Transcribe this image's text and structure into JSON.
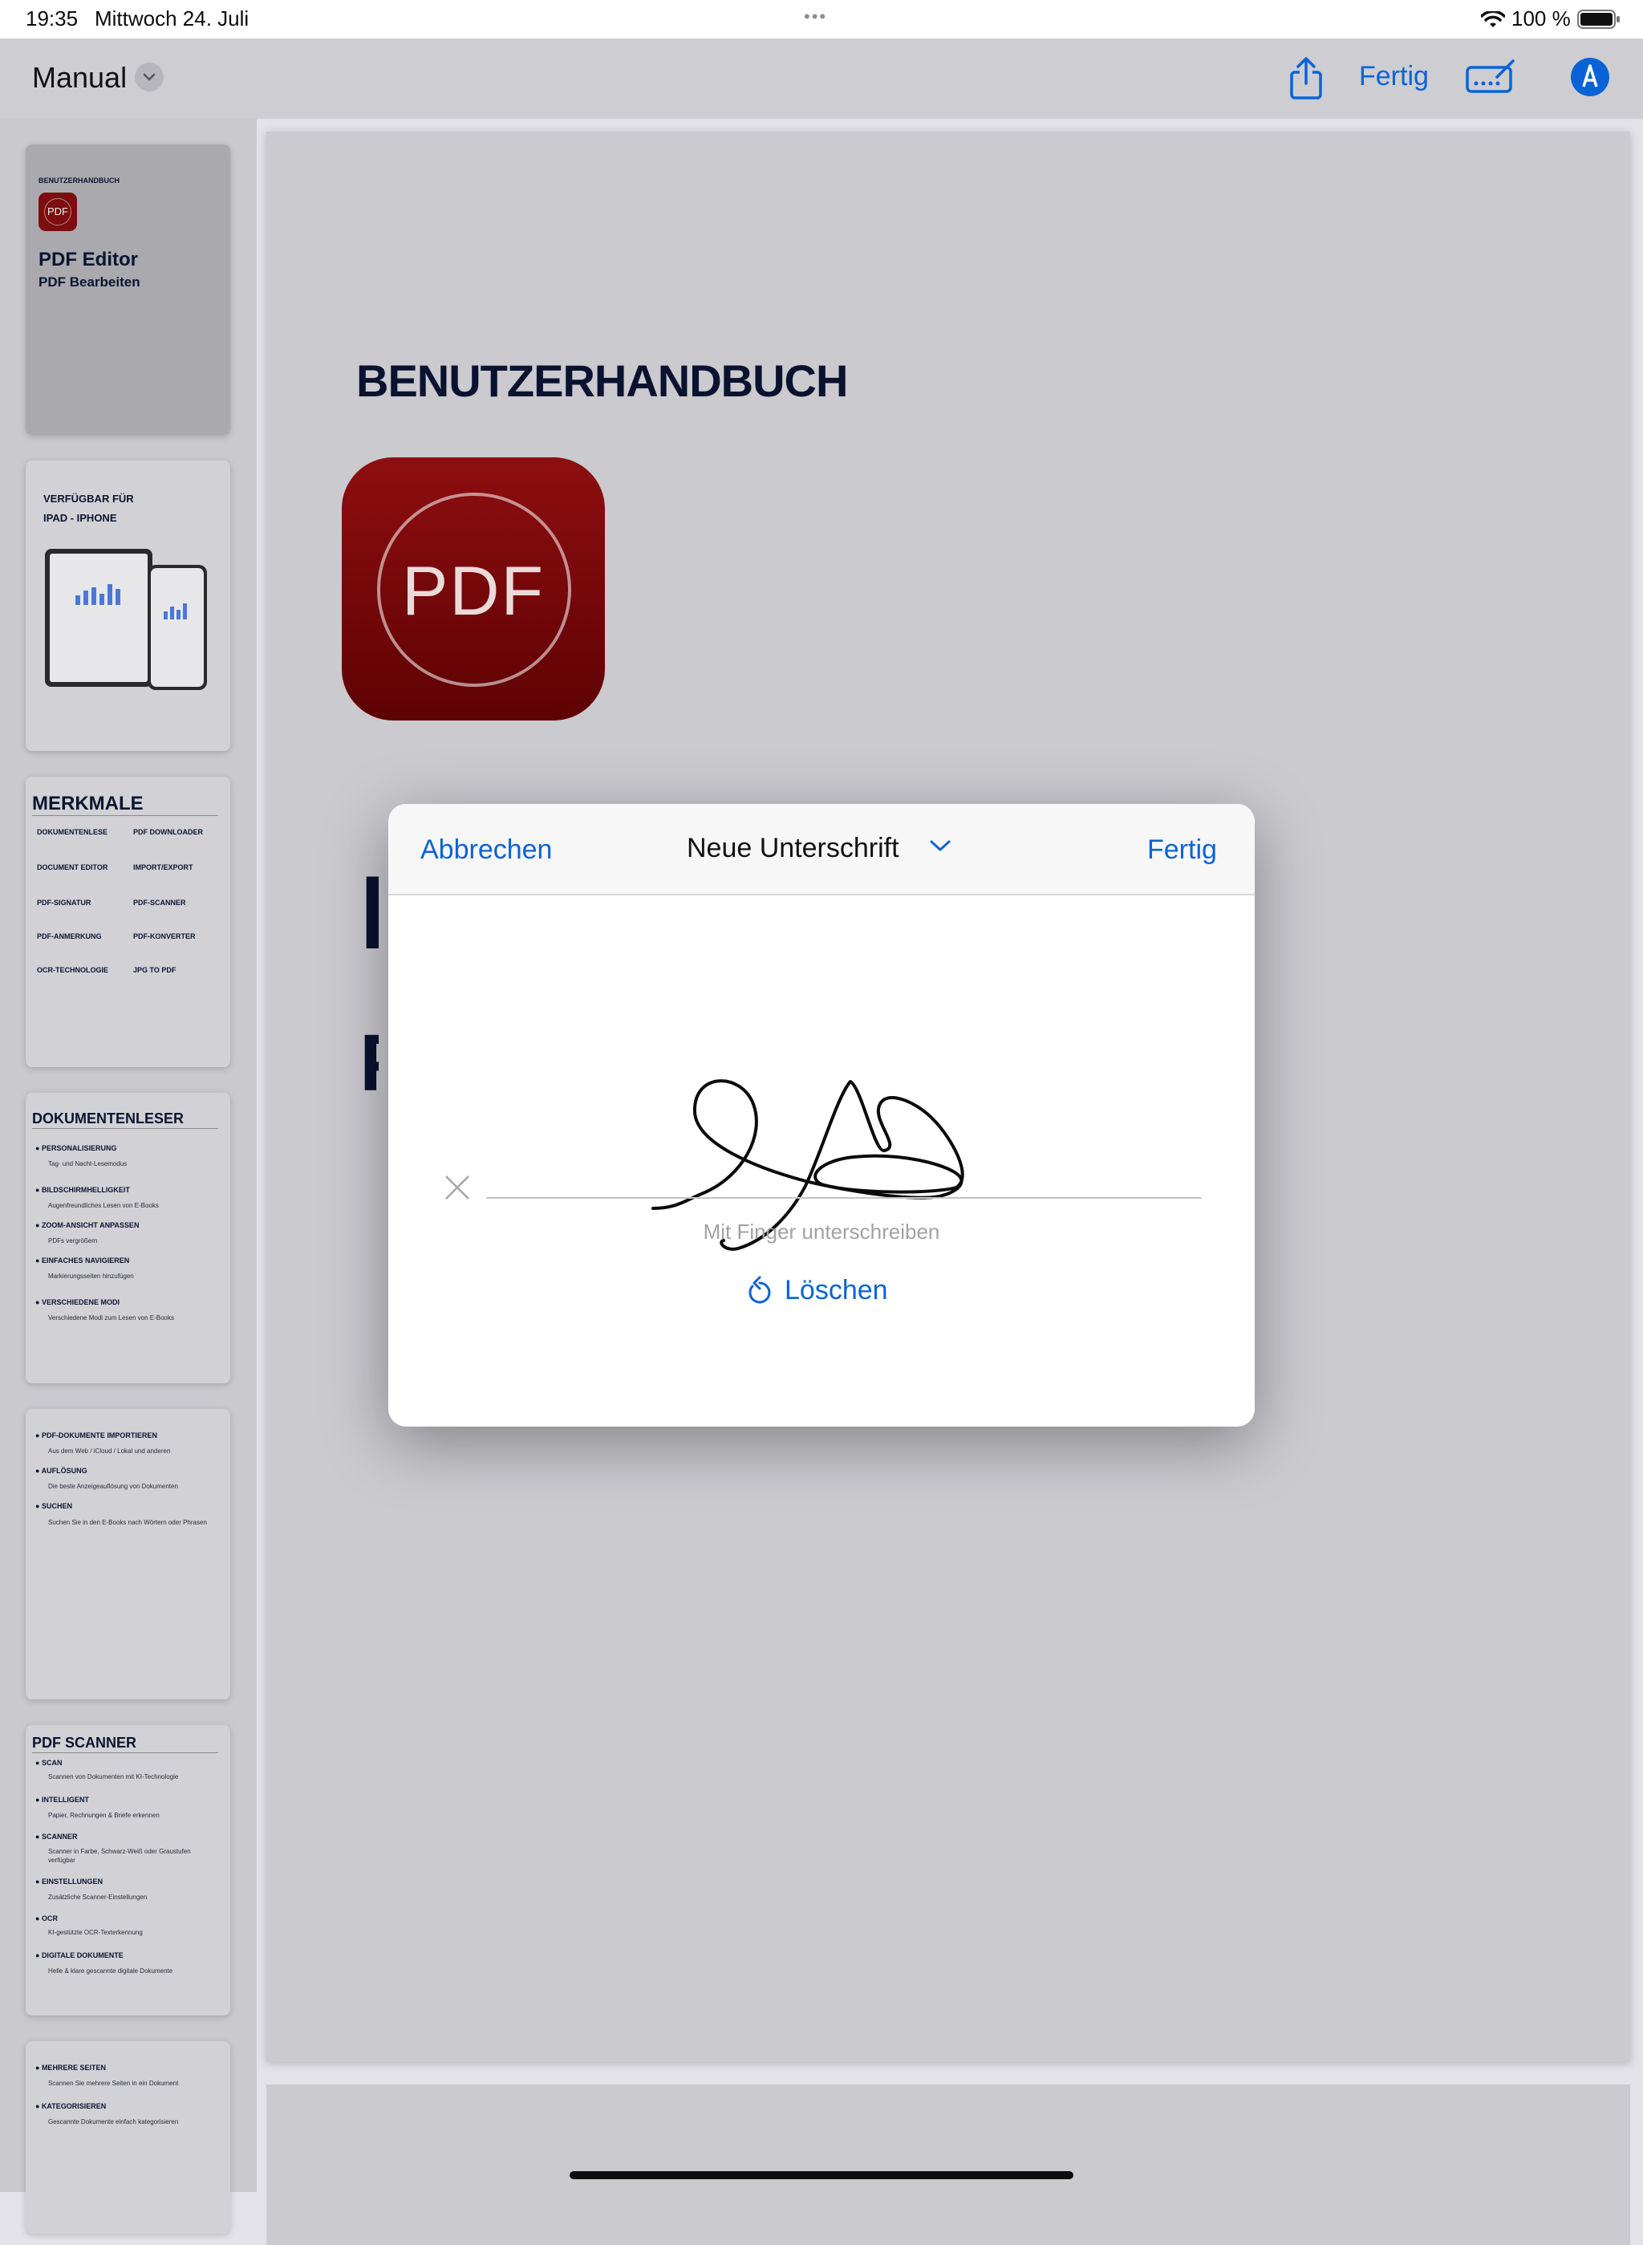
{
  "status_bar": {
    "time": "19:35",
    "date": "Mittwoch 24. Juli",
    "dots": "•••",
    "battery_text": "100 %"
  },
  "nav": {
    "title": "Manual",
    "done_label": "Fertig",
    "icons": [
      "share-icon",
      "keyboard-pencil-icon",
      "markup-pen-icon"
    ]
  },
  "thumbnails": [
    {
      "header": "BENUTZERHANDBUCH",
      "logo_text": "PDF",
      "title": "PDF Editor",
      "subtitle": "PDF Bearbeiten"
    },
    {
      "title_line1": "VERFÜGBAR FÜR",
      "title_line2": "IPAD - IPHONE"
    },
    {
      "title": "MERKMALE",
      "items": [
        "DOKUMENTENLESE",
        "PDF DOWNLOADER",
        "DOCUMENT EDITOR",
        "IMPORT/EXPORT",
        "PDF-SIGNATUR",
        "PDF-SCANNER",
        "PDF-ANMERKUNG",
        "PDF-KONVERTER",
        "OCR-TECHNOLOGIE",
        "JPG TO PDF"
      ]
    },
    {
      "title": "DOKUMENTENLESER",
      "items": [
        {
          "head": "PERSONALISIERUNG",
          "sub": "Tag- und Nacht-Lesemodus"
        },
        {
          "head": "BILDSCHIRMHELLIGKEIT",
          "sub": "Augenfreundliches Lesen von E-Books"
        },
        {
          "head": "ZOOM-ANSICHT ANPASSEN",
          "sub": "PDFs vergrößern"
        },
        {
          "head": "EINFACHES NAVIGIEREN",
          "sub": "Markierungsseiten hinzufügen"
        },
        {
          "head": "VERSCHIEDENE MODI",
          "sub": "Verschiedene Modi zum Lesen von E-Books"
        }
      ]
    },
    {
      "items": [
        {
          "head": "PDF-DOKUMENTE IMPORTIEREN",
          "sub": "Aus dem Web / iCloud / Lokal und anderen"
        },
        {
          "head": "AUFLÖSUNG",
          "sub": "Die beste Anzeigeauflösung von Dokumenten"
        },
        {
          "head": "SUCHEN",
          "sub": "Suchen Sie in den E-Books nach Wörtern oder Phrasen"
        }
      ]
    },
    {
      "title": "PDF SCANNER",
      "items": [
        {
          "head": "SCAN",
          "sub": "Scannen von Dokumenten mit KI-Technologie"
        },
        {
          "head": "INTELLIGENT",
          "sub": "Papier, Rechnungen & Briefe erkennen"
        },
        {
          "head": "SCANNER",
          "sub": "Scanner in Farbe, Schwarz-Weiß oder Graustufen verfügbar"
        },
        {
          "head": "EINSTELLUNGEN",
          "sub": "Zusätzliche Scanner-Einstellungen"
        },
        {
          "head": "OCR",
          "sub": "KI-gestützte OCR-Texterkennung"
        },
        {
          "head": "DIGITALE DOKUMENTE",
          "sub": "Helle & klare gescannte digitale Dokumente"
        }
      ]
    },
    {
      "items": [
        {
          "head": "MEHRERE SEITEN",
          "sub": "Scannen Sie mehrere Seiten in ein Dokument"
        },
        {
          "head": "KATEGORISIEREN",
          "sub": "Gescannte Dokumente einfach kategorisieren"
        }
      ]
    }
  ],
  "page": {
    "heading": "BENUTZERHANDBUCH",
    "logo_text": "PDF",
    "partial_glyph_1": "P",
    "partial_glyph_2": "P"
  },
  "dialog": {
    "cancel_label": "Abbrechen",
    "title": "Neue Unterschrift",
    "done_label": "Fertig",
    "hint": "Mit Finger unterschreiben",
    "clear_label": "Löschen"
  },
  "colors": {
    "accent": "#0a63d6",
    "navy_text": "#0a1230",
    "logo_red": "#8e0e10"
  }
}
